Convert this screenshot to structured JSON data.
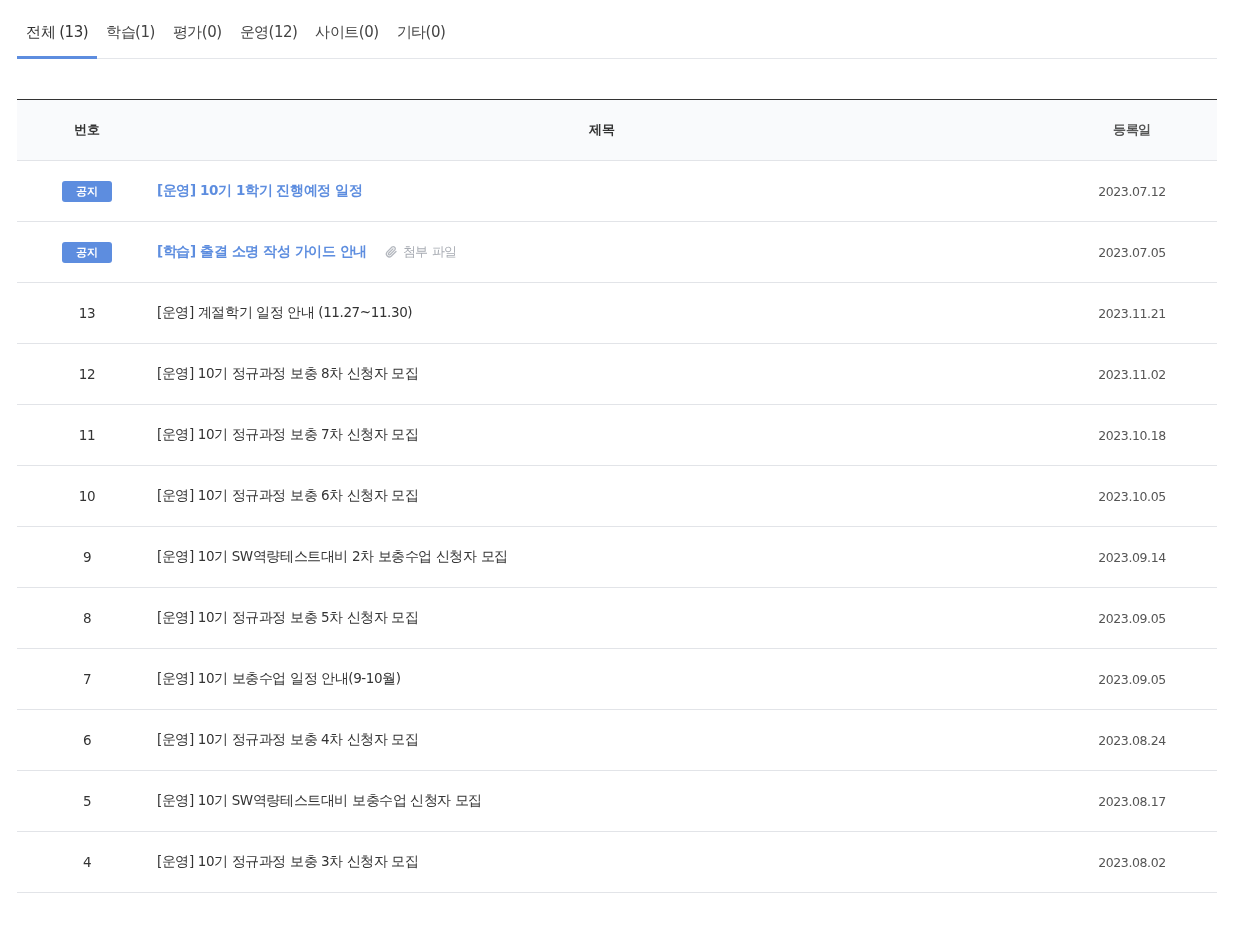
{
  "tabs": [
    {
      "label": "전체 (13)",
      "selected": true
    },
    {
      "label": "학습(1)",
      "selected": false
    },
    {
      "label": "평가(0)",
      "selected": false
    },
    {
      "label": "운영(12)",
      "selected": false
    },
    {
      "label": "사이트(0)",
      "selected": false
    },
    {
      "label": "기타(0)",
      "selected": false
    }
  ],
  "table": {
    "columns": [
      "번호",
      "제목",
      "등록일"
    ],
    "rows": [
      {
        "kind": "notice",
        "number": "공지",
        "title": "[운영] 10기 1학기 진행예정 일정",
        "date": "2023.07.12"
      },
      {
        "kind": "notice",
        "number": "공지",
        "title": "[학습] 출결 소명 작성 가이드 안내",
        "attachment": "첨부 파일",
        "date": "2023.07.05"
      },
      {
        "kind": "post",
        "number": "13",
        "title": "[운영] 계절학기 일정 안내 (11.27~11.30)",
        "date": "2023.11.21"
      },
      {
        "kind": "post",
        "number": "12",
        "title": "[운영] 10기 정규과정 보충 8차 신청자 모집",
        "date": "2023.11.02"
      },
      {
        "kind": "post",
        "number": "11",
        "title": "[운영] 10기 정규과정 보충 7차 신청자 모집",
        "date": "2023.10.18"
      },
      {
        "kind": "post",
        "number": "10",
        "title": "[운영] 10기 정규과정 보충 6차 신청자 모집",
        "date": "2023.10.05"
      },
      {
        "kind": "post",
        "number": "9",
        "title": "[운영] 10기 SW역량테스트대비 2차 보충수업 신청자 모집",
        "date": "2023.09.14"
      },
      {
        "kind": "post",
        "number": "8",
        "title": "[운영] 10기 정규과정 보충 5차 신청자 모집",
        "date": "2023.09.05"
      },
      {
        "kind": "post",
        "number": "7",
        "title": "[운영] 10기 보충수업 일정 안내(9-10월)",
        "date": "2023.09.05"
      },
      {
        "kind": "post",
        "number": "6",
        "title": "[운영] 10기 정규과정 보충 4차 신청자 모집",
        "date": "2023.08.24"
      },
      {
        "kind": "post",
        "number": "5",
        "title": "[운영] 10기 SW역량테스트대비 보충수업 신청자 모집",
        "date": "2023.08.17"
      },
      {
        "kind": "post",
        "number": "4",
        "title": "[운영] 10기 정규과정 보충 3차 신청자 모집",
        "date": "2023.08.02"
      }
    ]
  }
}
